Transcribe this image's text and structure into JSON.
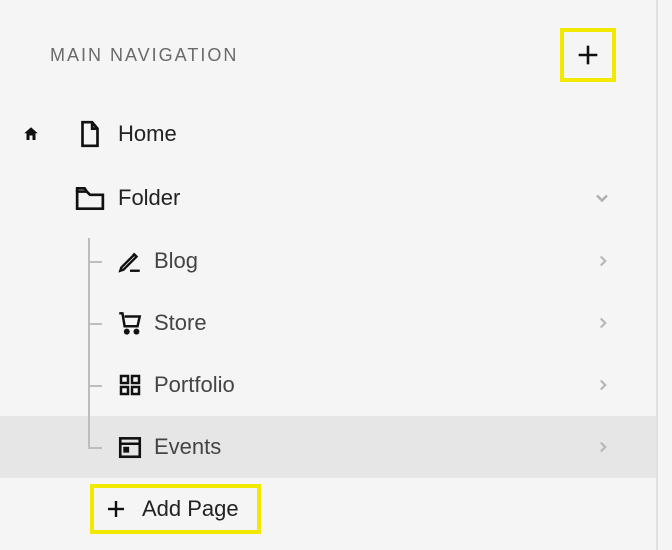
{
  "section": {
    "title": "MAIN NAVIGATION"
  },
  "colors": {
    "highlight": "#f2e900"
  },
  "items": {
    "home": {
      "label": "Home"
    },
    "folder": {
      "label": "Folder",
      "children": {
        "blog": {
          "label": "Blog"
        },
        "store": {
          "label": "Store"
        },
        "portfolio": {
          "label": "Portfolio"
        },
        "events": {
          "label": "Events"
        }
      }
    }
  },
  "add_page": {
    "label": "Add Page"
  }
}
